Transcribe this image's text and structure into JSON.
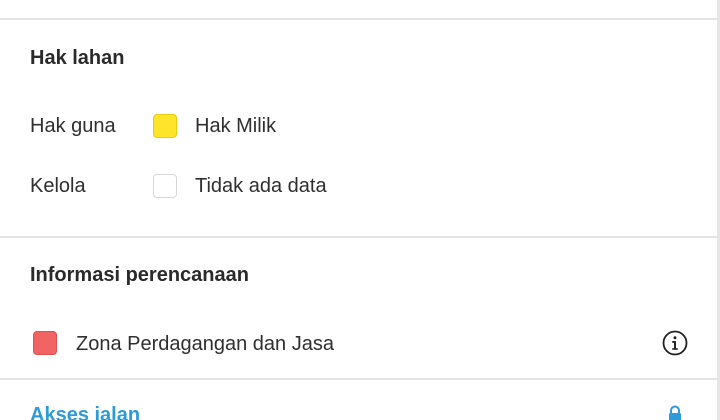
{
  "land_rights": {
    "title": "Hak lahan",
    "rows": [
      {
        "label": "Hak guna",
        "swatch_color": "#ffe52a",
        "legend": "Hak Milik"
      },
      {
        "label": "Kelola",
        "swatch_color": "#ffffff",
        "legend": "Tidak ada data"
      }
    ]
  },
  "planning": {
    "title": "Informasi perencanaan",
    "zone": {
      "swatch_color": "#f26464",
      "label": "Zona Perdagangan dan Jasa"
    },
    "info_icon": "info-circle-icon"
  },
  "road_access": {
    "title": "Akses jalan",
    "icon": "lock-icon",
    "accent": "#2d9bd8"
  }
}
